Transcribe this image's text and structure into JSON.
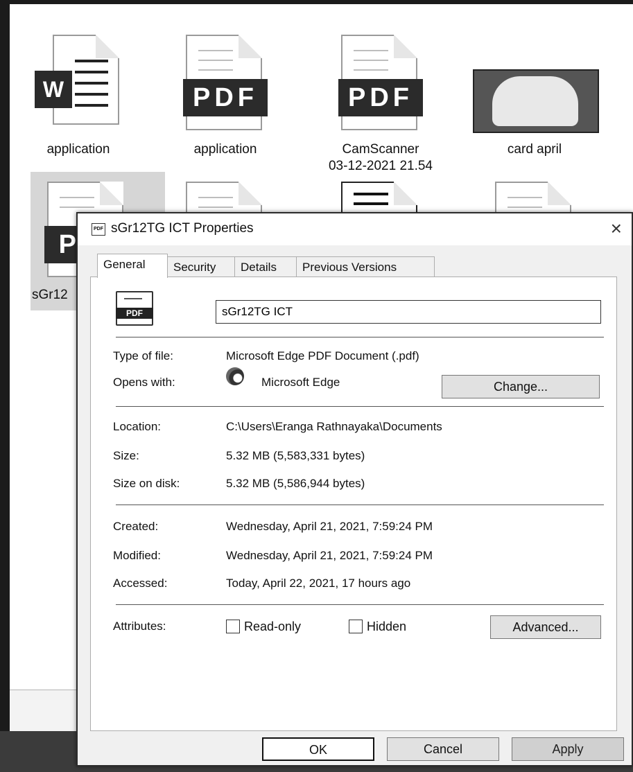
{
  "explorer": {
    "files": [
      {
        "name": "application",
        "type": "word"
      },
      {
        "name": "application",
        "type": "pdf"
      },
      {
        "name": "CamScanner\n03-12-2021 21.54",
        "type": "pdf"
      },
      {
        "name": "card april",
        "type": "image"
      }
    ],
    "row2": [
      {
        "name": "sGr12",
        "type": "pdf",
        "selected": true,
        "badge_text": "P D"
      },
      {
        "type": "doc"
      },
      {
        "type": "doc-dark"
      },
      {
        "type": "doc"
      }
    ],
    "pdf_badge": "PDF",
    "word_badge": "W"
  },
  "dialog": {
    "title": "sGr12TG ICT Properties",
    "close": "×",
    "tabs": [
      "General",
      "Security",
      "Details",
      "Previous Versions"
    ],
    "active_tab": "General",
    "file_icon_label": "PDF",
    "filename": "sGr12TG ICT",
    "type_of_file_label": "Type of file:",
    "type_of_file": "Microsoft Edge PDF Document (.pdf)",
    "opens_with_label": "Opens with:",
    "opens_with": "Microsoft Edge",
    "change_button": "Change...",
    "location_label": "Location:",
    "location": "C:\\Users\\Eranga Rathnayaka\\Documents",
    "size_label": "Size:",
    "size": "5.32 MB (5,583,331 bytes)",
    "size_on_disk_label": "Size on disk:",
    "size_on_disk": "5.32 MB (5,586,944 bytes)",
    "created_label": "Created:",
    "created": "Wednesday, April 21, 2021, 7:59:24 PM",
    "modified_label": "Modified:",
    "modified": "Wednesday, April 21, 2021, 7:59:24 PM",
    "accessed_label": "Accessed:",
    "accessed": "Today, April 22, 2021, 17 hours ago",
    "attributes_label": "Attributes:",
    "readonly_label": "Read-only",
    "hidden_label": "Hidden",
    "advanced_button": "Advanced...",
    "ok_button": "OK",
    "cancel_button": "Cancel",
    "apply_button": "Apply"
  }
}
